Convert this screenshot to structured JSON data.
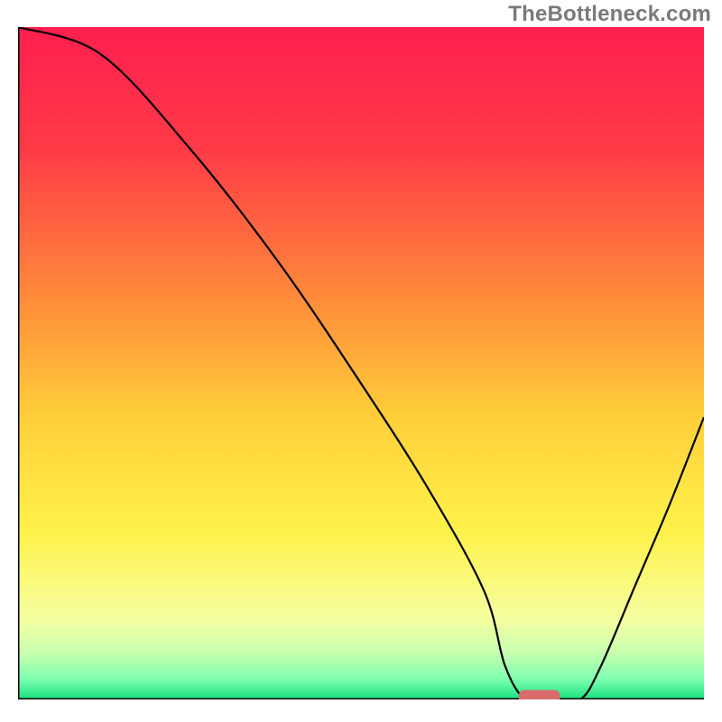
{
  "watermark": "TheBottleneck.com",
  "chart_data": {
    "type": "line",
    "title": "",
    "xlabel": "",
    "ylabel": "",
    "xlim": [
      0,
      100
    ],
    "ylim": [
      0,
      100
    ],
    "background_gradient": {
      "stops": [
        {
          "offset": 0.0,
          "color": "#ff1f4f"
        },
        {
          "offset": 0.18,
          "color": "#ff3a47"
        },
        {
          "offset": 0.4,
          "color": "#ff8a3a"
        },
        {
          "offset": 0.58,
          "color": "#ffcf3a"
        },
        {
          "offset": 0.75,
          "color": "#fff24a"
        },
        {
          "offset": 0.88,
          "color": "#f6ffa0"
        },
        {
          "offset": 0.93,
          "color": "#c9ffb0"
        },
        {
          "offset": 0.97,
          "color": "#7dffb0"
        },
        {
          "offset": 1.0,
          "color": "#17e07e"
        }
      ]
    },
    "series": [
      {
        "name": "bottleneck-curve",
        "x": [
          0,
          12,
          25,
          38,
          50,
          60,
          68,
          71,
          74,
          78,
          82,
          85,
          90,
          95,
          100
        ],
        "values": [
          100,
          96,
          82,
          65,
          47,
          31,
          16,
          5,
          0,
          0,
          0,
          5,
          17,
          29,
          42
        ]
      }
    ],
    "marker": {
      "name": "optimal-point",
      "x": 76,
      "y": 0,
      "color": "#d96a6a",
      "width": 6,
      "height": 2
    },
    "axes": {
      "left": {
        "x": 0,
        "y1": 0,
        "y2": 100
      },
      "bottom": {
        "y": 0,
        "x1": 0,
        "x2": 100
      }
    }
  }
}
